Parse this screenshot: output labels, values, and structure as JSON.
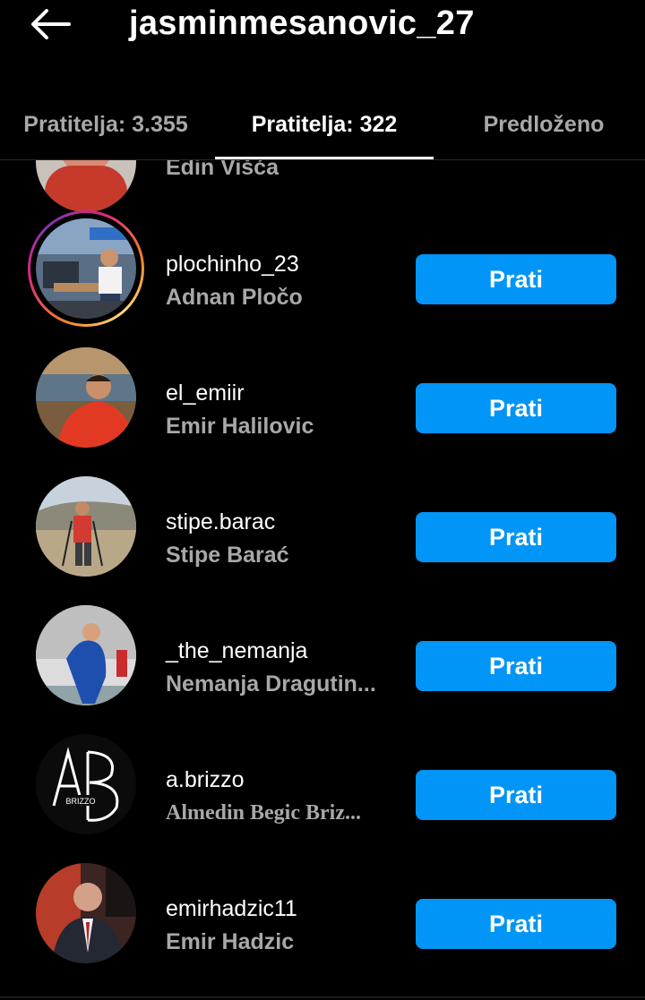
{
  "header": {
    "title": "jasminmesanovic_27",
    "back_icon": "arrow-left-icon"
  },
  "tabs": [
    {
      "label": "Pratitelja: 3.355",
      "active": false
    },
    {
      "label": "Pratitelja: 322",
      "active": true
    },
    {
      "label": "Predloženo",
      "active": false
    }
  ],
  "list": {
    "items": [
      {
        "username": "",
        "full_name": "Edin Višća",
        "button_label": "",
        "avatar_icon": "profile-photo"
      },
      {
        "username": "plochinho_23",
        "full_name": "Adnan Pločo",
        "button_label": "Prati",
        "avatar_icon": "profile-photo",
        "has_story": true
      },
      {
        "username": "el_emiir",
        "full_name": "Emir Halilovic",
        "button_label": "Prati",
        "avatar_icon": "profile-photo"
      },
      {
        "username": "stipe.barac",
        "full_name": "Stipe Barać",
        "button_label": "Prati",
        "avatar_icon": "profile-photo"
      },
      {
        "username": "_the_nemanja",
        "full_name": "Nemanja Dragutin...",
        "button_label": "Prati",
        "avatar_icon": "profile-photo"
      },
      {
        "username": "a.brizzo",
        "full_name": "Almedin Begic Briz...",
        "button_label": "Prati",
        "avatar_icon": "ab-logo",
        "logo_text": "AB",
        "logo_subtext": "BRIZZO"
      },
      {
        "username": "emirhadzic11",
        "full_name": "Emir Hadzic",
        "button_label": "Prati",
        "avatar_icon": "profile-photo"
      }
    ]
  },
  "colors": {
    "background": "#000000",
    "accent": "#0095f6",
    "secondary_text": "#a8a8a8"
  }
}
